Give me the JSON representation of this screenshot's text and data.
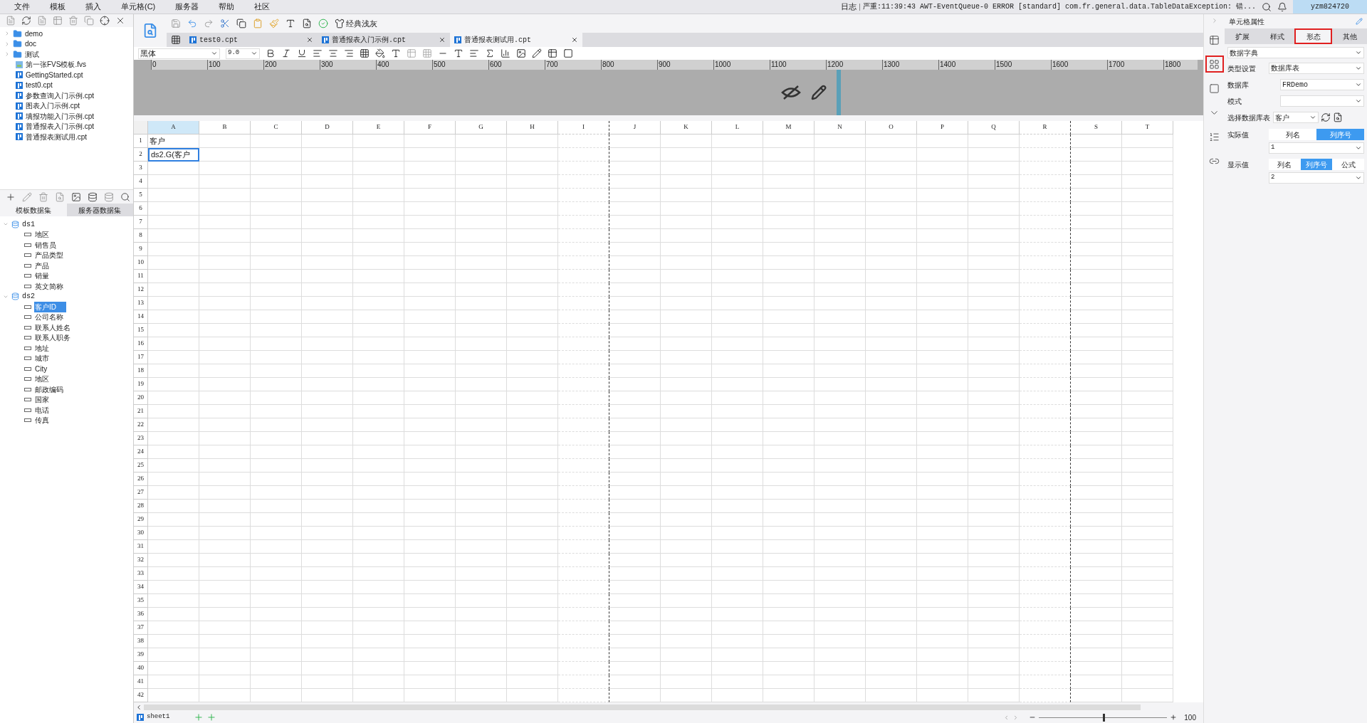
{
  "menu_bar": {
    "items": [
      "文件",
      "模板",
      "插入",
      "单元格(C)",
      "服务器",
      "帮助",
      "社区"
    ],
    "log_label": "日志",
    "log_message": "严重:11:39:43 AWT-EventQueue-0 ERROR [standard] com.fr.general.data.TableDataException: 错...",
    "user": "yzm824720"
  },
  "file_tree": {
    "items": [
      {
        "label": "demo",
        "kind": "folder"
      },
      {
        "label": "doc",
        "kind": "folder"
      },
      {
        "label": "测试",
        "kind": "folder"
      },
      {
        "label": "第一张FVS模板.fvs",
        "kind": "fvs"
      },
      {
        "label": "GettingStarted.cpt",
        "kind": "cpt"
      },
      {
        "label": "test0.cpt",
        "kind": "cpt"
      },
      {
        "label": "参数查询入门示例.cpt",
        "kind": "cpt"
      },
      {
        "label": "图表入门示例.cpt",
        "kind": "cpt"
      },
      {
        "label": "填报功能入门示例.cpt",
        "kind": "cpt"
      },
      {
        "label": "普通报表入门示例.cpt",
        "kind": "cpt"
      },
      {
        "label": "普通报表测试用.cpt",
        "kind": "cpt"
      }
    ]
  },
  "dataset_panel": {
    "tabs": [
      {
        "label": "模板数据集",
        "selected": true
      },
      {
        "label": "服务器数据集",
        "selected": false
      }
    ],
    "datasets": [
      {
        "name": "ds1",
        "expanded": true,
        "children": [
          {
            "name": "地区",
            "selected": false
          },
          {
            "name": "销售员",
            "selected": false
          },
          {
            "name": "产品类型",
            "selected": false
          },
          {
            "name": "产品",
            "selected": false
          },
          {
            "name": "销量",
            "selected": false
          },
          {
            "name": "英文简称",
            "selected": false
          }
        ]
      },
      {
        "name": "ds2",
        "expanded": true,
        "children": [
          {
            "name": "客户ID",
            "selected": true
          },
          {
            "name": "公司名称",
            "selected": false
          },
          {
            "name": "联系人姓名",
            "selected": false
          },
          {
            "name": "联系人职务",
            "selected": false
          },
          {
            "name": "地址",
            "selected": false
          },
          {
            "name": "城市",
            "selected": false
          },
          {
            "name": "City",
            "selected": false
          },
          {
            "name": "地区",
            "selected": false
          },
          {
            "name": "邮政编码",
            "selected": false
          },
          {
            "name": "国家",
            "selected": false
          },
          {
            "name": "电话",
            "selected": false
          },
          {
            "name": "传真",
            "selected": false
          }
        ]
      }
    ]
  },
  "toolbar": {
    "theme": "经典浅灰"
  },
  "doc_tabs": [
    {
      "label": "test0.cpt",
      "selected": false
    },
    {
      "label": "普通报表入门示例.cpt",
      "selected": false
    },
    {
      "label": "普通报表测试用.cpt",
      "selected": true
    }
  ],
  "format_bar": {
    "font": "黑体",
    "size": "9.0"
  },
  "ruler": {
    "marks": [
      "0",
      "100",
      "200",
      "300",
      "400",
      "500",
      "600",
      "700",
      "800",
      "900",
      "1000",
      "1100",
      "1200",
      "1300",
      "1400",
      "1500",
      "1600",
      "1700",
      "1800"
    ]
  },
  "sheet": {
    "columns": [
      {
        "label": "A",
        "selected": true,
        "page_break_after": false
      },
      {
        "label": "B",
        "selected": false,
        "page_break_after": false
      },
      {
        "label": "C",
        "selected": false,
        "page_break_after": false
      },
      {
        "label": "D",
        "selected": false,
        "page_break_after": false
      },
      {
        "label": "E",
        "selected": false,
        "page_break_after": false
      },
      {
        "label": "F",
        "selected": false,
        "page_break_after": false
      },
      {
        "label": "G",
        "selected": false,
        "page_break_after": false
      },
      {
        "label": "H",
        "selected": false,
        "page_break_after": false
      },
      {
        "label": "I",
        "selected": false,
        "page_break_after": true
      },
      {
        "label": "J",
        "selected": false,
        "page_break_after": false
      },
      {
        "label": "K",
        "selected": false,
        "page_break_after": false
      },
      {
        "label": "L",
        "selected": false,
        "page_break_after": false
      },
      {
        "label": "M",
        "selected": false,
        "page_break_after": false
      },
      {
        "label": "N",
        "selected": false,
        "page_break_after": false
      },
      {
        "label": "O",
        "selected": false,
        "page_break_after": false
      },
      {
        "label": "P",
        "selected": false,
        "page_break_after": false
      },
      {
        "label": "Q",
        "selected": false,
        "page_break_after": false
      },
      {
        "label": "R",
        "selected": false,
        "page_break_after": true
      },
      {
        "label": "S",
        "selected": false,
        "page_break_after": false
      },
      {
        "label": "T",
        "selected": false,
        "page_break_after": false
      }
    ],
    "rows": [
      {
        "number": "1",
        "cells": [
          {
            "text": "客户",
            "selected": false
          }
        ]
      },
      {
        "number": "2",
        "cells": [
          {
            "text": "ds2.G(客户",
            "selected": true
          }
        ]
      },
      {
        "number": "3"
      },
      {
        "number": "4"
      },
      {
        "number": "5"
      },
      {
        "number": "6"
      },
      {
        "number": "7"
      },
      {
        "number": "8"
      },
      {
        "number": "9"
      },
      {
        "number": "10"
      },
      {
        "number": "11"
      },
      {
        "number": "12"
      },
      {
        "number": "13"
      },
      {
        "number": "14"
      },
      {
        "number": "15"
      },
      {
        "number": "16"
      },
      {
        "number": "17"
      },
      {
        "number": "18"
      },
      {
        "number": "19"
      },
      {
        "number": "20"
      },
      {
        "number": "21"
      },
      {
        "number": "22"
      },
      {
        "number": "23"
      },
      {
        "number": "24"
      },
      {
        "number": "25"
      },
      {
        "number": "26"
      },
      {
        "number": "27"
      },
      {
        "number": "28"
      },
      {
        "number": "29"
      },
      {
        "number": "30"
      },
      {
        "number": "31"
      },
      {
        "number": "32"
      },
      {
        "number": "33"
      },
      {
        "number": "34"
      },
      {
        "number": "35"
      },
      {
        "number": "36"
      },
      {
        "number": "37"
      },
      {
        "number": "38"
      },
      {
        "number": "39"
      },
      {
        "number": "40"
      },
      {
        "number": "41"
      },
      {
        "number": "42"
      }
    ]
  },
  "side_icons": [
    {
      "kind": "cell",
      "highlighted": false
    },
    {
      "kind": "widget",
      "highlighted": true
    },
    {
      "kind": "frame",
      "highlighted": false
    },
    {
      "kind": "dropdown",
      "highlighted": false
    },
    {
      "kind": "list",
      "highlighted": false
    },
    {
      "kind": "link",
      "highlighted": false
    }
  ],
  "properties": {
    "title": "单元格属性",
    "tabs": [
      {
        "label": "扩展",
        "selected": false,
        "highlighted": false
      },
      {
        "label": "样式",
        "selected": false,
        "highlighted": false
      },
      {
        "label": "形态",
        "selected": true,
        "highlighted": true
      },
      {
        "label": "其他",
        "selected": false,
        "highlighted": false
      }
    ],
    "widget_type": "数据字典",
    "fields": [
      {
        "label": "类型设置",
        "value": "数据库表",
        "kind": "select"
      },
      {
        "label": "数据库",
        "value": "FRDemo",
        "kind": "select"
      },
      {
        "label": "模式",
        "kind": "select"
      },
      {
        "label": "选择数据库表",
        "value": "客户",
        "kind": "table-select"
      }
    ],
    "actual_value": {
      "label": "实际值",
      "options": [
        {
          "label": "列名",
          "selected": false
        },
        {
          "label": "列序号",
          "selected": true
        }
      ],
      "value": "1"
    },
    "display_value": {
      "label": "显示值",
      "options": [
        {
          "label": "列名",
          "selected": false
        },
        {
          "label": "列序号",
          "selected": true
        },
        {
          "label": "公式",
          "selected": false
        }
      ],
      "value": "2"
    }
  },
  "status_bar": {
    "sheet": "sheet1",
    "zoom": {
      "value": "100",
      "level": 0.5
    }
  }
}
